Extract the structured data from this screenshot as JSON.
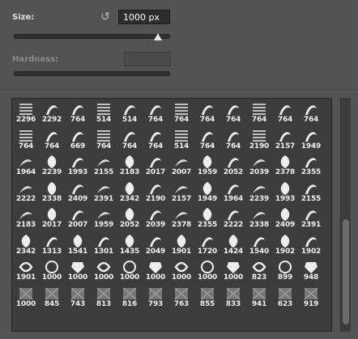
{
  "size": {
    "label": "Size:",
    "value": "1000 px",
    "reset_icon": "reset-arrow-icon",
    "slider_fraction": 0.93
  },
  "hardness": {
    "label": "Hardness:",
    "value": "",
    "slider_fraction": 0.0
  },
  "brush_grid": {
    "selected_index": 104,
    "thumbnails": [
      "2296",
      "2292",
      "764",
      "514",
      "514",
      "764",
      "764",
      "764",
      "764",
      "764",
      "764",
      "764",
      "764",
      "764",
      "669",
      "764",
      "764",
      "764",
      "514",
      "764",
      "764",
      "2190",
      "2157",
      "1949",
      "1964",
      "2239",
      "1993",
      "2155",
      "2183",
      "2017",
      "2007",
      "1959",
      "2052",
      "2039",
      "2378",
      "2355",
      "2222",
      "2338",
      "2409",
      "2391",
      "2342",
      "2190",
      "2157",
      "1949",
      "1964",
      "2239",
      "1993",
      "2155",
      "2183",
      "2017",
      "2007",
      "1959",
      "2052",
      "2039",
      "2378",
      "2355",
      "2222",
      "2338",
      "2409",
      "2391",
      "2342",
      "1313",
      "1541",
      "1301",
      "1435",
      "2049",
      "1901",
      "1720",
      "1424",
      "1540",
      "1902",
      "1902",
      "1901",
      "1000",
      "1000",
      "1000",
      "1000",
      "1000",
      "1000",
      "1000",
      "1000",
      "823",
      "899",
      "948",
      "1000",
      "845",
      "743",
      "813",
      "816",
      "793",
      "763",
      "855",
      "833",
      "941",
      "623",
      "919"
    ]
  },
  "colors": {
    "panel": "#535353",
    "grid_bg": "#3c3c3c",
    "selection": "#7ea6e0"
  }
}
